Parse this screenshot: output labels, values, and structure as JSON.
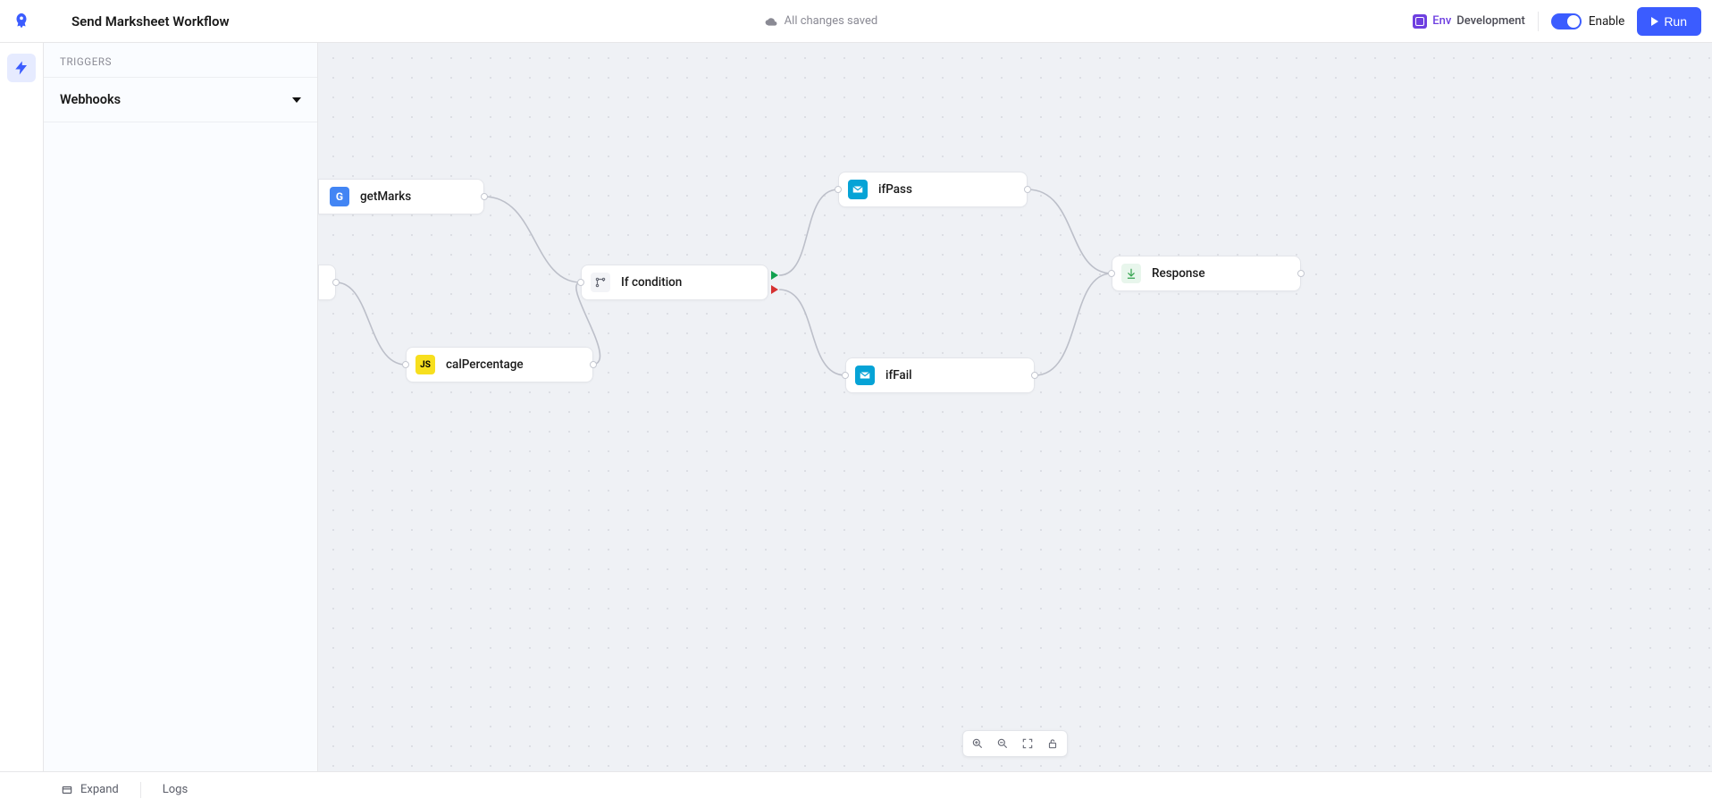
{
  "header": {
    "title": "Send Marksheet Workflow",
    "save_status": "All changes saved",
    "env_label": "Env",
    "env_name": "Development",
    "enable_label": "Enable",
    "run_label": "Run"
  },
  "sidebar": {
    "section_label": "TRIGGERS",
    "items": [
      {
        "label": "Webhooks"
      }
    ]
  },
  "nodes": {
    "getMarks": {
      "label": "getMarks"
    },
    "calPercentage": {
      "label": "calPercentage"
    },
    "ifCond": {
      "label": "If condition"
    },
    "ifPass": {
      "label": "ifPass"
    },
    "ifFail": {
      "label": "ifFail"
    },
    "response": {
      "label": "Response"
    }
  },
  "footer": {
    "expand": "Expand",
    "logs": "Logs"
  }
}
